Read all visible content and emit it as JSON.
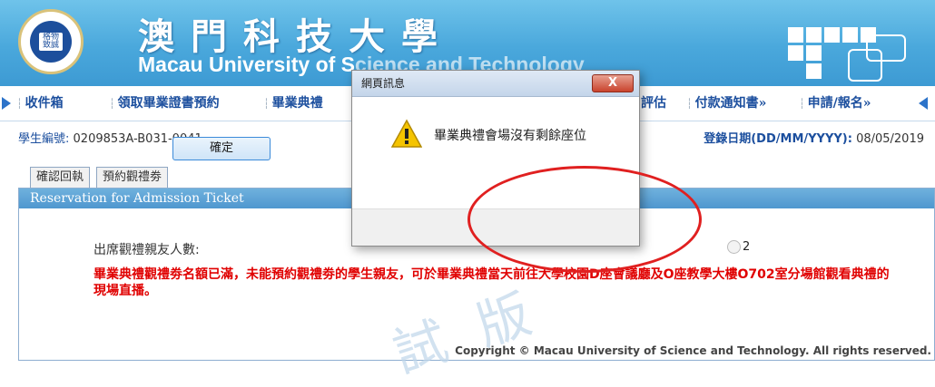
{
  "header": {
    "title_zh": "澳門科技大學",
    "title_en_visible": "Macau University of S",
    "title_en_hidden": "cience and Technology",
    "logo_text": "格物\n致誠"
  },
  "nav": {
    "items": [
      "收件箱",
      "領取畢業證書預約",
      "畢業典禮",
      "評估",
      "付款通知書»",
      "申請/報名»"
    ]
  },
  "student": {
    "id_label": "學生編號:",
    "id_value": "0209853A-B031-0041",
    "date_label": "登錄日期(DD/MM/YYYY):",
    "date_value": "08/05/2019"
  },
  "tabs": [
    "確認回執",
    "預約觀禮劵"
  ],
  "panel": {
    "header": "Reservation for Admission Ticket",
    "guests_label": "出席觀禮親友人數:",
    "radio_option": "2",
    "notice": "畢業典禮觀禮劵名額已滿，未能預約觀禮劵的學生親友，可於畢業典禮當天前往大學校園D座會議廳及O座教學大樓O702室分場館觀看典禮的現場直播。"
  },
  "watermark": "試 版",
  "copyright": "Copyright © Macau University of Science and Technology. All rights reserved.",
  "dialog": {
    "title": "網頁訊息",
    "close": "X",
    "message": "畢業典禮會場沒有剩餘座位",
    "ok": "確定"
  },
  "colors": {
    "banner": "#4aa8dc",
    "nav_text": "#1c4f9e",
    "notice": "#e00000",
    "oval": "#e02020"
  }
}
